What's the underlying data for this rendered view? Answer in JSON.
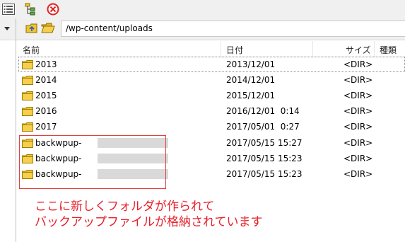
{
  "toolbar": {
    "buttons": [
      {
        "icon": "list-view-icon"
      },
      {
        "icon": "tree-view-icon"
      },
      {
        "icon": "stop-icon"
      }
    ]
  },
  "pathbar": {
    "path": "/wp-content/uploads"
  },
  "columns": {
    "name": "名前",
    "date": "日付",
    "size": "サイズ",
    "type": "種類"
  },
  "rows": [
    {
      "name": "2013",
      "date": "2013/12/01",
      "size": "<DIR>",
      "selected": true
    },
    {
      "name": "2014",
      "date": "2014/12/01",
      "size": "<DIR>"
    },
    {
      "name": "2015",
      "date": "2015/12/01",
      "size": "<DIR>"
    },
    {
      "name": "2016",
      "date": "2016/12/01  0:14",
      "size": "<DIR>"
    },
    {
      "name": "2017",
      "date": "2017/05/01  0:27",
      "size": "<DIR>"
    },
    {
      "name": "backwpup-",
      "date": "2017/05/15 15:27",
      "size": "<DIR>",
      "redacted": true
    },
    {
      "name": "backwpup-",
      "date": "2017/05/15 15:23",
      "size": "<DIR>",
      "redacted": true
    },
    {
      "name": "backwpup-",
      "date": "2017/05/15 15:23",
      "size": "<DIR>",
      "redacted": true
    }
  ],
  "annotation": {
    "line1": "ここに新しくフォルダが作られて",
    "line2": "バックアップファイルが格納されています",
    "color": "#e8202a"
  }
}
